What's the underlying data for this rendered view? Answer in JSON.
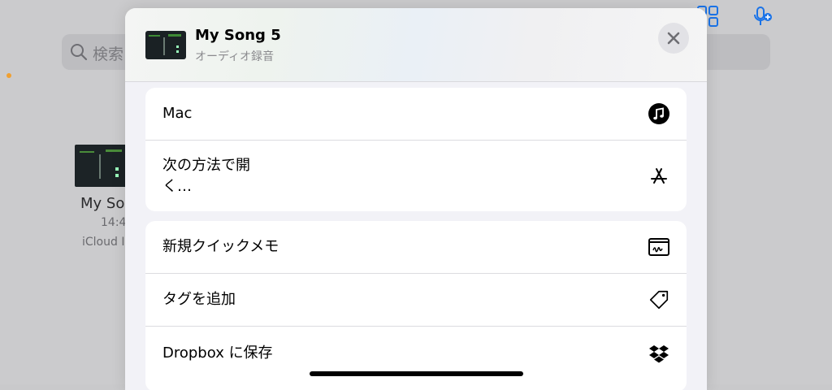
{
  "background": {
    "search_placeholder": "検索",
    "file": {
      "name": "My So",
      "time": "14:4",
      "location": "iCloud I"
    }
  },
  "sheet": {
    "title": "My Song 5",
    "subtitle": "オーディオ録音",
    "close_icon": "xmark-icon",
    "groups": [
      {
        "rows": [
          {
            "label": "Mac",
            "icon": "music-note-circle-icon"
          },
          {
            "label": "次の方法で開く…",
            "icon": "app-store-icon"
          }
        ]
      },
      {
        "rows": [
          {
            "label": "新規クイックメモ",
            "icon": "quick-note-icon"
          },
          {
            "label": "タグを追加",
            "icon": "tag-icon"
          },
          {
            "label": "Dropbox に保存",
            "icon": "dropbox-icon"
          }
        ]
      }
    ]
  },
  "colors": {
    "accent": "#1a73e8",
    "sheet_bg": "#f2f2f7",
    "row_bg": "#ffffff"
  }
}
